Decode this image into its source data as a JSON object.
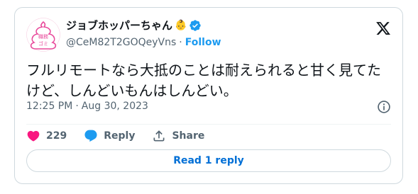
{
  "author": {
    "display_name": "ジョブホッパーちゃん",
    "emoji": "👶",
    "handle": "@CeM82T2GOQeyVns",
    "separator": "·",
    "follow_label": "Follow",
    "avatar_text": [
      "職務",
      "ゴミ"
    ]
  },
  "tweet": {
    "text": "フルリモートなら大抵のことは耐えられると甘く見てたけど、しんどいもんはしんどい。",
    "time": "12:25 PM",
    "separator": "·",
    "date": "Aug 30, 2023"
  },
  "actions": {
    "like_count": "229",
    "reply_label": "Reply",
    "share_label": "Share"
  },
  "read_replies_label": "Read 1 reply",
  "colors": {
    "like": "#f91880",
    "reply": "#1d9bf0",
    "link": "#1d9bf0",
    "verified": "#1d9bf0"
  }
}
